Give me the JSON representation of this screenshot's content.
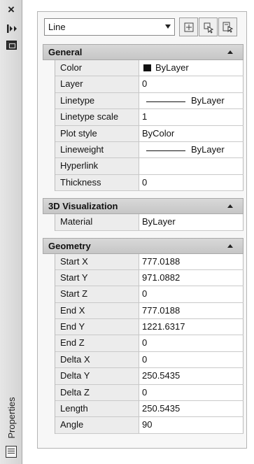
{
  "palette": {
    "title": "Properties"
  },
  "toolbar": {
    "object_type": "Line"
  },
  "sections": {
    "general": {
      "title": "General",
      "rows": [
        {
          "label": "Color",
          "value": "ByLayer"
        },
        {
          "label": "Layer",
          "value": "0"
        },
        {
          "label": "Linetype",
          "value": "ByLayer"
        },
        {
          "label": "Linetype scale",
          "value": "1"
        },
        {
          "label": "Plot style",
          "value": "ByColor"
        },
        {
          "label": "Lineweight",
          "value": "ByLayer"
        },
        {
          "label": "Hyperlink",
          "value": ""
        },
        {
          "label": "Thickness",
          "value": "0"
        }
      ]
    },
    "viz3d": {
      "title": "3D Visualization",
      "rows": [
        {
          "label": "Material",
          "value": "ByLayer"
        }
      ]
    },
    "geometry": {
      "title": "Geometry",
      "rows": [
        {
          "label": "Start X",
          "value": "777.0188"
        },
        {
          "label": "Start Y",
          "value": "971.0882"
        },
        {
          "label": "Start Z",
          "value": "0"
        },
        {
          "label": "End X",
          "value": "777.0188"
        },
        {
          "label": "End Y",
          "value": "1221.6317"
        },
        {
          "label": "End Z",
          "value": "0"
        },
        {
          "label": "Delta X",
          "value": "0"
        },
        {
          "label": "Delta Y",
          "value": "250.5435"
        },
        {
          "label": "Delta Z",
          "value": "0"
        },
        {
          "label": "Length",
          "value": "250.5435"
        },
        {
          "label": "Angle",
          "value": "90"
        }
      ]
    }
  },
  "icons": {
    "close": "close-icon",
    "autohide": "autohide-icon",
    "menu": "menu-icon",
    "toggle_pickadd": "toggle-pickadd-icon",
    "select_objects": "select-objects-icon",
    "quick_select": "quick-select-icon"
  }
}
